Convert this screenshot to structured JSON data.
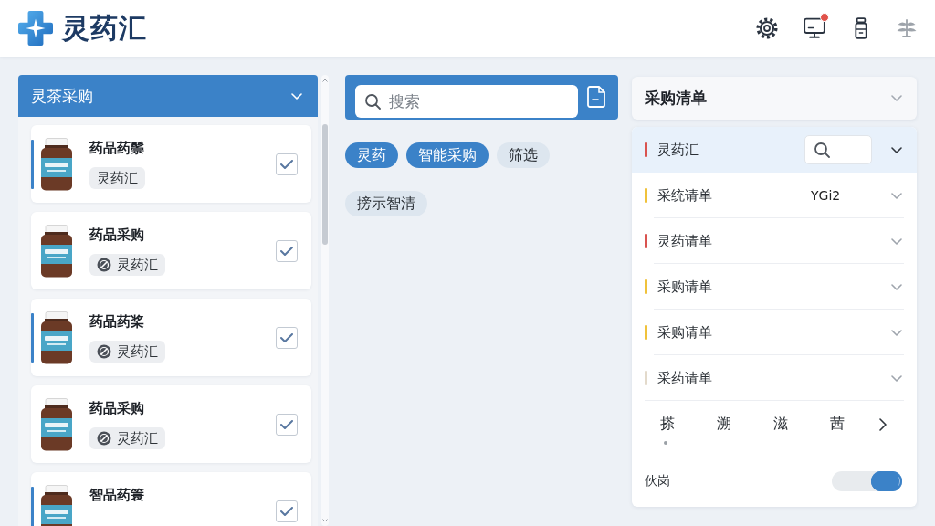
{
  "header": {
    "brand": "灵药汇",
    "monitor_alert": true
  },
  "procurement": {
    "title": "灵茶采购",
    "items": [
      {
        "name": "药品药鬃",
        "badge": {
          "text": "灵药汇",
          "icon": false
        },
        "checked": true,
        "selected": true
      },
      {
        "name": "药品采购",
        "badge": {
          "text": "灵药汇",
          "icon": true
        },
        "checked": true,
        "selected": false
      },
      {
        "name": "药品药桨",
        "badge": {
          "text": "灵药汇",
          "icon": true
        },
        "checked": true,
        "selected": true
      },
      {
        "name": "药品采购",
        "badge": {
          "text": "灵药汇",
          "icon": true
        },
        "checked": true,
        "selected": false
      },
      {
        "name": "智品药簑",
        "checked": true,
        "selected": true
      }
    ]
  },
  "search": {
    "placeholder": "搜索"
  },
  "filters": [
    {
      "label": "灵药",
      "selected": true
    },
    {
      "label": "智能采购",
      "selected": true
    },
    {
      "label": "筛选",
      "selected": false
    }
  ],
  "suggestions": [
    {
      "label": "搒示智清",
      "selected": false
    }
  ],
  "order_list": {
    "title": "采购清单",
    "rows": [
      {
        "label": "灵药汇",
        "color": "#d9534f",
        "selected": true,
        "search_field": true
      },
      {
        "label": "采统请单",
        "color": "#f0c23b",
        "selected": false,
        "value": "YGi2"
      },
      {
        "label": "灵药请单",
        "color": "#d9534f",
        "selected": false
      },
      {
        "label": "采购请单",
        "color": "#f0c23b",
        "selected": false
      },
      {
        "label": "采购请单",
        "color": "#f0c23b",
        "selected": false
      },
      {
        "label": "采药请单",
        "color": "#e3dacb",
        "selected": false
      }
    ],
    "tabs": [
      {
        "label": "搽",
        "selected": true
      },
      {
        "label": "溯",
        "selected": false
      },
      {
        "label": "滋",
        "selected": false
      },
      {
        "label": "茜",
        "selected": false
      }
    ],
    "toggle": {
      "label": "伙岗",
      "on": true
    }
  }
}
